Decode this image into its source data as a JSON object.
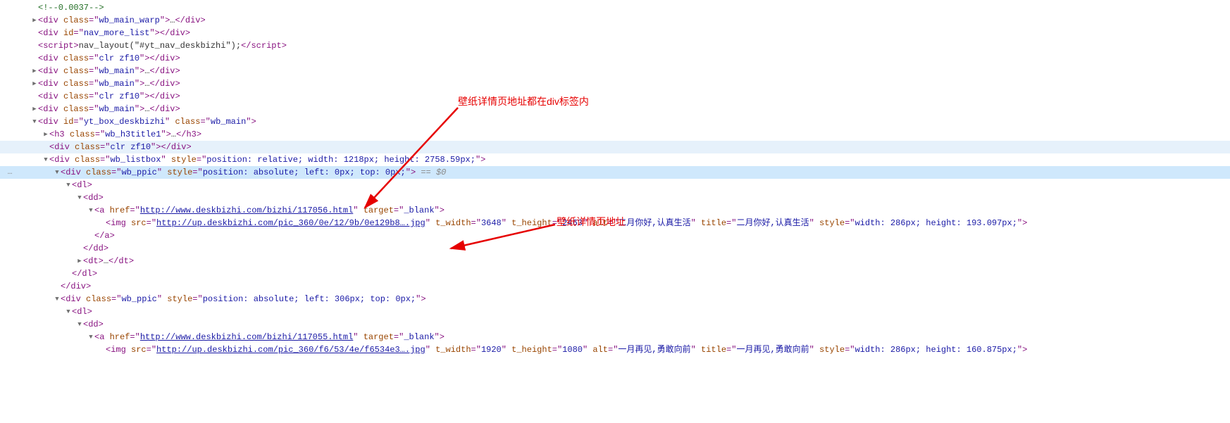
{
  "gutter_ellipsis": "…",
  "selected_marker": " == $0",
  "annotations": {
    "a1": "壁纸详情页地址都在div标签内",
    "a2": "壁纸详情页地址"
  },
  "tokens": {
    "lt": "<",
    "gt": ">",
    "lts": "</",
    "sgt": "/>",
    "eq": "=",
    "q": "\"",
    "ell": "…",
    "div": "div",
    "script": "script",
    "h3": "h3",
    "dl": "dl",
    "dd": "dd",
    "dt": "dt",
    "a": "a",
    "img": "img",
    "class": "class",
    "id": "id",
    "style": "style",
    "href": "href",
    "target": "target",
    "src": "src",
    "t_width": "t_width",
    "t_height": "t_height",
    "alt": "alt",
    "title": "title",
    "comment": "<!--0.0037-->",
    "wb_main_warp": "wb_main_warp",
    "nav_more_list": "nav_more_list",
    "scriptbody": "nav_layout(\"#yt_nav_deskbizhi\");",
    "clr_zf10": "clr zf10",
    "wb_main": "wb_main",
    "yt_box": "yt_box_deskbizhi",
    "wb_h3title1": "wb_h3title1",
    "wb_listbox": "wb_listbox",
    "listbox_style": "position: relative; width: 1218px; height: 2758.59px;",
    "wb_ppic": "wb_ppic",
    "ppic1_style": "position: absolute; left: 0px; top: 0px;",
    "ppic2_style": "position: absolute; left: 306px; top: 0px;",
    "href1": "http://www.deskbizhi.com/bizhi/117056.html",
    "href2": "http://www.deskbizhi.com/bizhi/117055.html",
    "blank": "_blank",
    "src1": "http://up.deskbizhi.com/pic_360/0e/12/9b/0e129b8….jpg",
    "src2": "http://up.deskbizhi.com/pic_360/f6/53/4e/f6534e3….jpg",
    "tw1": "3648",
    "th1": "2463",
    "alt1": "二月你好,认真生活",
    "title1": "二月你好,认真生活",
    "imgstyle1": "width: 286px; height: 193.097px;",
    "tw2": "1920",
    "th2": "1080",
    "alt2": "一月再见,勇敢向前",
    "title2": "一月再见,勇敢向前",
    "imgstyle2": "width: 286px; height: 160.875px;"
  }
}
